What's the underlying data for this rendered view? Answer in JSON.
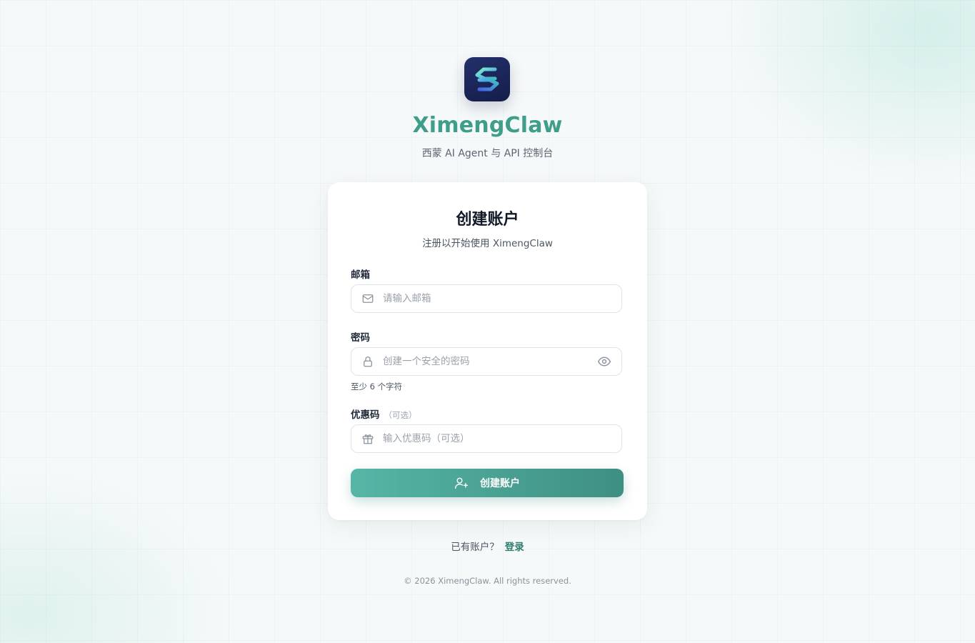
{
  "brand": {
    "name": "XimengClaw",
    "subtitle": "西蒙 AI Agent 与 API 控制台",
    "logo_icon": "stylized-s-logo"
  },
  "card": {
    "title": "创建账户",
    "subtitle": "注册以开始使用 XimengClaw"
  },
  "form": {
    "email": {
      "label": "邮箱",
      "placeholder": "请输入邮箱",
      "value": "",
      "icon": "mail-icon"
    },
    "password": {
      "label": "密码",
      "placeholder": "创建一个安全的密码",
      "value": "",
      "icon": "lock-icon",
      "toggle_icon": "eye-icon",
      "hint": "至少 6 个字符"
    },
    "coupon": {
      "label": "优惠码",
      "optional_tag": "（可选）",
      "placeholder": "输入优惠码（可选）",
      "value": "",
      "icon": "gift-icon"
    },
    "submit": {
      "label": "创建账户",
      "icon": "user-plus-icon"
    }
  },
  "login": {
    "prompt": "已有账户？",
    "link_label": "登录"
  },
  "footer": {
    "copyright": "© 2026 XimengClaw. All rights reserved."
  },
  "colors": {
    "brand_teal": "#3e9e8a",
    "button_start": "#56b6a6",
    "button_end": "#3e8f82",
    "logo_bg": "#1b2658"
  }
}
